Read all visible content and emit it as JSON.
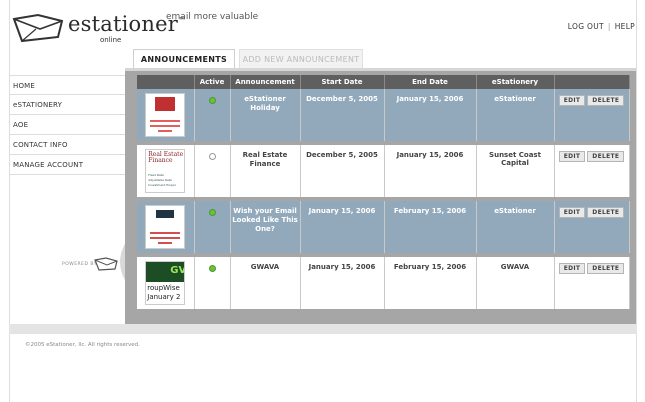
{
  "header": {
    "logo_text": "estationer",
    "logo_sub": "online",
    "tagline": "email more valuable",
    "logout_label": "LOG OUT",
    "help_label": "HELP",
    "separator": "|"
  },
  "tabs": [
    {
      "label": "ANNOUNCEMENTS",
      "active": true
    },
    {
      "label": "ADD NEW ANNOUNCEMENT",
      "active": false
    }
  ],
  "sidebar": {
    "items": [
      {
        "label": "HOME"
      },
      {
        "label": "eSTATIONERY"
      },
      {
        "label": "AOE"
      },
      {
        "label": "CONTACT INFO"
      },
      {
        "label": "MANAGE ACCOUNT"
      }
    ],
    "powered_by": "POWERED BY"
  },
  "table": {
    "headers": [
      "",
      "Active",
      "Announcement",
      "Start Date",
      "End Date",
      "eStationery",
      ""
    ],
    "edit_label": "EDIT",
    "delete_label": "DELETE",
    "rows": [
      {
        "active": true,
        "announcement": "eStationer Holiday",
        "start": "December 5, 2005",
        "end": "January 15, 2006",
        "stationery": "eStationer",
        "style": "blue",
        "thumb": "holiday"
      },
      {
        "active": false,
        "announcement": "Real Estate Finance",
        "start": "December 5, 2005",
        "end": "January 15, 2006",
        "stationery": "Sunset Coast Capital",
        "style": "white",
        "thumb": "realestate"
      },
      {
        "active": true,
        "announcement": "Wish your Email Looked Like This One?",
        "start": "January 15, 2006",
        "end": "February 15, 2006",
        "stationery": "eStationer",
        "style": "blue",
        "thumb": "wish"
      },
      {
        "active": true,
        "announcement": "GWAVA",
        "start": "January 15, 2006",
        "end": "February 15, 2006",
        "stationery": "GWAVA",
        "style": "white",
        "thumb": "gwava"
      }
    ]
  },
  "thumbs": {
    "realestate_title": "Real Estate Finance",
    "realestate_lines": [
      "Fixed Rate",
      "Adjustable Rate",
      "Investment Proper"
    ],
    "gwava_gv": "GV",
    "gwava_lines": [
      "roupWise",
      "January 2"
    ]
  },
  "footer": {
    "copyright": "©2005 eStationer, llc. All rights reserved."
  },
  "colors": {
    "row_blue": "#92a9bb",
    "row_white": "#ffffff",
    "header_bg": "#5f5f5f",
    "active_green": "#6ac13b"
  }
}
